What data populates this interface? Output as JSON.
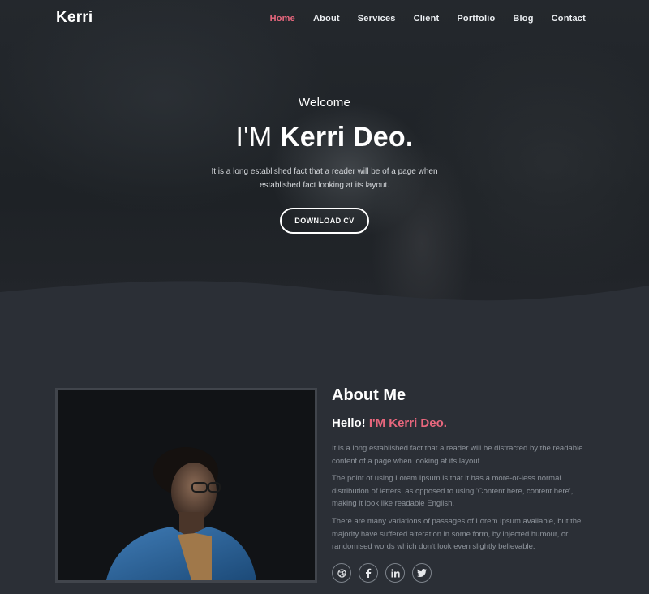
{
  "brand": {
    "logo": "Kerri"
  },
  "nav": {
    "items": [
      {
        "label": "Home",
        "active": true
      },
      {
        "label": "About"
      },
      {
        "label": "Services"
      },
      {
        "label": "Client"
      },
      {
        "label": "Portfolio"
      },
      {
        "label": "Blog"
      },
      {
        "label": "Contact"
      }
    ]
  },
  "hero": {
    "welcome": "Welcome",
    "title_prefix": "I'M ",
    "title_name": "Kerri Deo.",
    "description": "It is a long established fact that a reader will be of a page when established fact looking at its layout.",
    "cta_label": "DOWNLOAD CV"
  },
  "about": {
    "title_bold": "About",
    "title_rest": " Me",
    "hello_prefix": "Hello! ",
    "hello_name": "I'M Kerri Deo.",
    "paragraphs": [
      "It is a long established fact that a reader will be distracted by the readable content of a page when looking at its layout.",
      "The point of using Lorem Ipsum is that it has a more-or-less normal distribution of letters, as opposed to using 'Content here, content here', making it look like readable English.",
      "There are many variations of passages of Lorem Ipsum available, but the majority have suffered alteration in some form, by injected humour, or randomised words which don't look even slightly believable."
    ],
    "social": [
      {
        "icon": "dribbble-icon",
        "glyph": "◎"
      },
      {
        "icon": "facebook-icon",
        "glyph": "f"
      },
      {
        "icon": "linkedin-icon",
        "glyph": "in"
      },
      {
        "icon": "twitter-icon",
        "glyph": "🐦"
      }
    ]
  },
  "colors": {
    "accent": "#e8677d",
    "background": "#2b2f36"
  }
}
